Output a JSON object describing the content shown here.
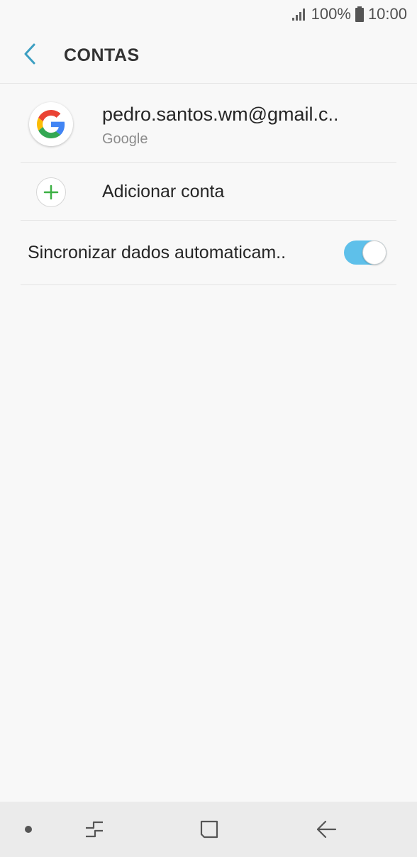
{
  "status_bar": {
    "battery_percent": "100%",
    "time": "10:00",
    "icons": [
      "signal-icon",
      "battery-icon"
    ]
  },
  "header": {
    "title": "CONTAS",
    "back_icon": "chevron-left-icon"
  },
  "accounts": [
    {
      "email": "pedro.santos.wm@gmail.c..",
      "type": "Google",
      "icon": "google-icon"
    }
  ],
  "add_account": {
    "label": "Adicionar conta",
    "icon": "plus-icon"
  },
  "sync": {
    "label": "Sincronizar dados automaticam..",
    "enabled": true
  },
  "nav_bar": {
    "items": [
      "dot-icon",
      "recent-apps-icon",
      "home-icon",
      "back-arrow-icon"
    ]
  },
  "colors": {
    "accent": "#5ec0ea",
    "back_chevron": "#3d9fc2",
    "plus_green": "#3cb043",
    "background": "#f8f8f8"
  }
}
